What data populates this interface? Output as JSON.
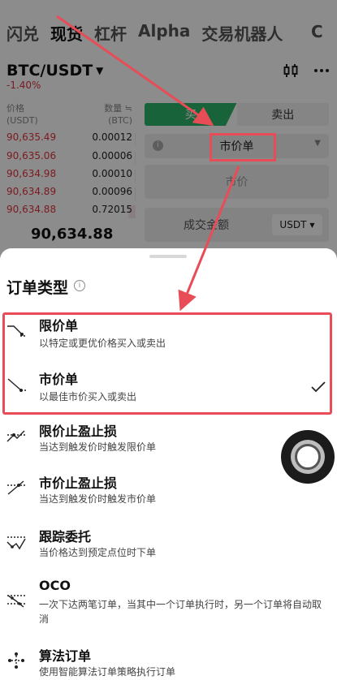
{
  "top_tabs": [
    "闪兑",
    "现货",
    "杠杆",
    "Alpha",
    "交易机器人"
  ],
  "top_tabs_overflow": "C",
  "active_tab": "现货",
  "pair": {
    "symbol": "BTC/USDT",
    "change": "-1.40%"
  },
  "order_book": {
    "price_header": "价格",
    "price_unit": "(USDT)",
    "qty_header": "数量 ≒",
    "qty_unit": "(BTC)",
    "rows": [
      {
        "price": "90,635.49",
        "qty": "0.00012",
        "depth_pct": 0.1
      },
      {
        "price": "90,635.06",
        "qty": "0.00006",
        "depth_pct": 0.05
      },
      {
        "price": "90,634.98",
        "qty": "0.00010",
        "depth_pct": 0.08
      },
      {
        "price": "90,634.89",
        "qty": "0.00096",
        "depth_pct": 0.12
      },
      {
        "price": "90,634.88",
        "qty": "0.72015",
        "depth_pct": 0.9
      }
    ],
    "last_price": "90,634.88"
  },
  "trade_panel": {
    "buy_label": "买",
    "sell_label": "卖出",
    "order_type_value": "市价单",
    "price_field": "市价",
    "amount_field": "成交金额",
    "amount_unit": "USDT"
  },
  "sheet": {
    "title": "订单类型",
    "options": [
      {
        "name": "限价单",
        "desc": "以特定或更优价格买入或卖出",
        "icon": "limit-order-icon"
      },
      {
        "name": "市价单",
        "desc": "以最佳市价买入或卖出",
        "icon": "market-order-icon",
        "selected": true
      },
      {
        "name": "限价止盈止损",
        "desc": "当达到触发价时触发限价单",
        "icon": "limit-tpsl-icon"
      },
      {
        "name": "市价止盈止损",
        "desc": "当达到触发价时触发市价单",
        "icon": "market-tpsl-icon"
      },
      {
        "name": "跟踪委托",
        "desc": "当价格达到预定点位时下单",
        "icon": "trailing-order-icon"
      },
      {
        "name": "OCO",
        "desc": "一次下达两笔订单，当其中一个订单执行时，另一个订单将自动取消",
        "icon": "oco-icon"
      },
      {
        "name": "算法订单",
        "desc": "使用智能算法订单策略执行订单",
        "icon": "algo-order-icon"
      }
    ]
  },
  "colors": {
    "accent_red": "#e84c57",
    "ask_red": "#e0333f",
    "buy_green": "#2fb56a"
  }
}
